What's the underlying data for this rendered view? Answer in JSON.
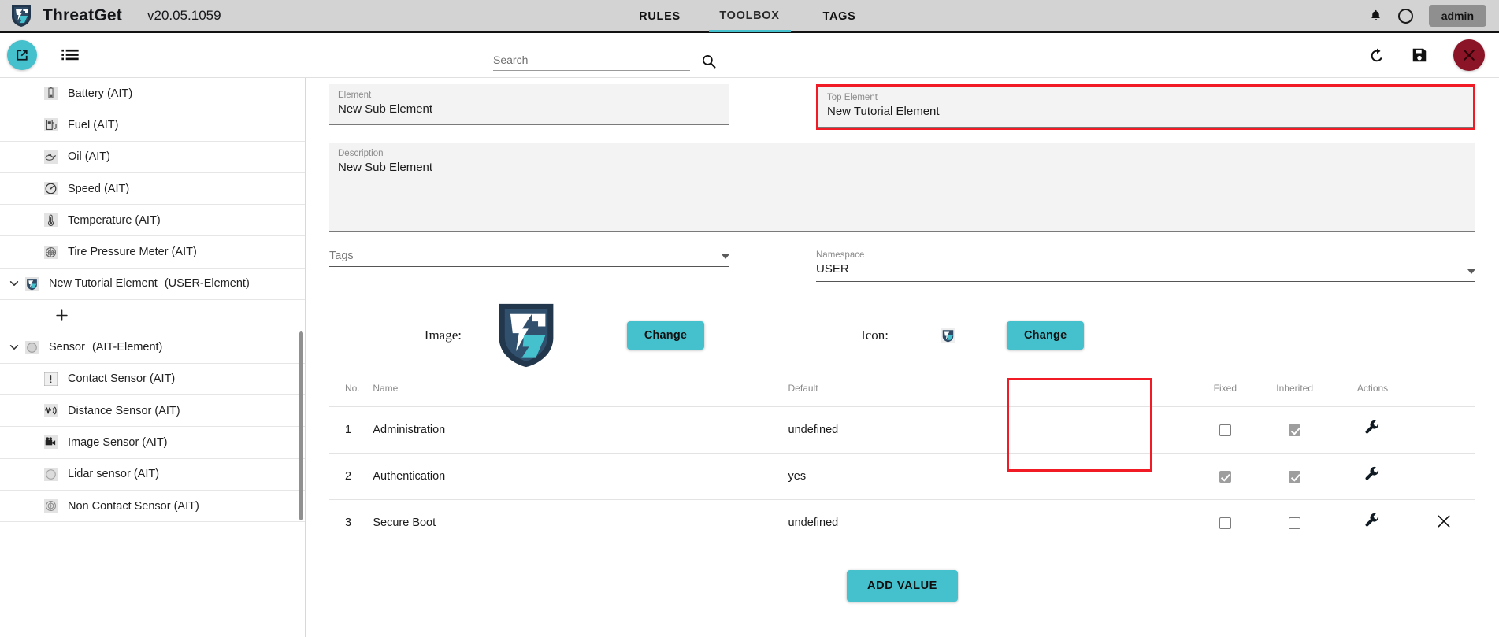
{
  "app": {
    "brand": "ThreatGet",
    "version": "v20.05.1059",
    "logo_icon": "threatget-shield-logo"
  },
  "topnav": {
    "tabs": [
      {
        "label": "RULES",
        "active": false
      },
      {
        "label": "TOOLBOX",
        "active": true
      },
      {
        "label": "TAGS",
        "active": false
      }
    ],
    "notifications_icon": "bell-icon",
    "account_icon": "user-circle-icon",
    "user_label": "admin"
  },
  "toolbar": {
    "open_icon": "open-external-icon",
    "list_icon": "list-icon",
    "search": {
      "value": "",
      "placeholder": "Search"
    },
    "search_icon": "search-icon",
    "undo_icon": "undo-icon",
    "save_icon": "save-floppy-icon",
    "close_icon": "close-x-icon"
  },
  "sidebar": {
    "items": [
      {
        "label": "Battery (AIT)",
        "icon": "battery-icon",
        "level": 2,
        "expandable": false
      },
      {
        "label": "Fuel (AIT)",
        "icon": "fuel-pump-icon",
        "level": 2,
        "expandable": false
      },
      {
        "label": "Oil (AIT)",
        "icon": "oil-can-icon",
        "level": 2,
        "expandable": false
      },
      {
        "label": "Speed (AIT)",
        "icon": "speedometer-icon",
        "level": 2,
        "expandable": false
      },
      {
        "label": "Temperature (AIT)",
        "icon": "thermometer-icon",
        "level": 2,
        "expandable": false
      },
      {
        "label": "Tire Pressure Meter (AIT)",
        "icon": "tire-pressure-icon",
        "level": 2,
        "expandable": false
      },
      {
        "label": "New Tutorial Element",
        "kind": "(USER-Element)",
        "icon": "threatget-shield-logo",
        "level": 1,
        "expandable": true,
        "expanded": true
      },
      {
        "label": "",
        "icon": "plus-icon",
        "level": 2,
        "is_add": true
      },
      {
        "label": "Sensor",
        "kind": "(AIT-Element)",
        "icon": "sensor-circle-icon",
        "level": 1,
        "expandable": true,
        "expanded": true
      },
      {
        "label": "Contact Sensor (AIT)",
        "icon": "contact-sensor-icon",
        "level": 2,
        "expandable": false
      },
      {
        "label": "Distance Sensor (AIT)",
        "icon": "distance-sensor-icon",
        "level": 2,
        "expandable": false
      },
      {
        "label": "Image Sensor (AIT)",
        "icon": "camera-icon",
        "level": 2,
        "expandable": false
      },
      {
        "label": "Lidar sensor (AIT)",
        "icon": "lidar-icon",
        "level": 2,
        "expandable": false
      },
      {
        "label": "Non Contact Sensor (AIT)",
        "icon": "non-contact-sensor-icon",
        "level": 2,
        "expandable": false
      }
    ]
  },
  "form": {
    "element": {
      "label": "Element",
      "value": "New Sub Element"
    },
    "top_element": {
      "label": "Top Element",
      "value": "New Tutorial Element",
      "highlighted": true
    },
    "description": {
      "label": "Description",
      "value": "New Sub Element"
    },
    "tags": {
      "placeholder": "Tags",
      "value": "",
      "options": []
    },
    "namespace": {
      "label": "Namespace",
      "value": "USER",
      "options": [
        "USER"
      ]
    }
  },
  "media": {
    "image_label": "Image:",
    "image_change_label": "Change",
    "icon_label": "Icon:",
    "icon_change_label": "Change"
  },
  "table": {
    "headers": {
      "no": "No.",
      "name": "Name",
      "default": "Default",
      "fixed": "Fixed",
      "inherited": "Inherited",
      "actions": "Actions"
    },
    "rows": [
      {
        "no": "1",
        "name": "Administration",
        "default": "undefined",
        "fixed": false,
        "inherited": true,
        "action_icon": "wrench-icon",
        "deletable": false
      },
      {
        "no": "2",
        "name": "Authentication",
        "default": "yes",
        "fixed": true,
        "inherited": true,
        "action_icon": "wrench-icon",
        "deletable": false
      },
      {
        "no": "3",
        "name": "Secure Boot",
        "default": "undefined",
        "fixed": false,
        "inherited": false,
        "action_icon": "wrench-icon",
        "deletable": true,
        "delete_icon": "close-x-icon"
      }
    ],
    "highlighted": true
  },
  "actions": {
    "add_value_label": "ADD VALUE"
  },
  "colors": {
    "accent": "#45c0cd",
    "highlight": "#f01b24",
    "topbar_bg": "#d3d3d3",
    "close_red": "#8b1426",
    "logo_dark": "#22374c"
  }
}
